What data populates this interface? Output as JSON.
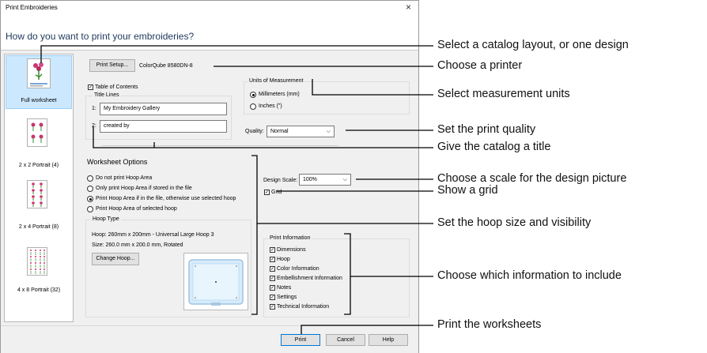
{
  "window": {
    "title": "Print Embroideries",
    "close": "×"
  },
  "header": {
    "prompt": "How do you want to print your embroideries?"
  },
  "layouts": [
    {
      "label": "Full worksheet"
    },
    {
      "label": "2 x 2 Portrait (4)"
    },
    {
      "label": "2 x 4 Portrait (8)"
    },
    {
      "label": "4 x 8 Portrait (32)"
    }
  ],
  "printer": {
    "setup_label": "Print Setup...",
    "name": "ColorQube 8580DN-8"
  },
  "toc": {
    "label": "Table of Contents",
    "checked": "✓"
  },
  "title_lines": {
    "legend": "Title Lines",
    "line1_num": "1:",
    "line1_value": "My Embroidery Gallery",
    "line2_num": "2:",
    "line2_value": "created by"
  },
  "units": {
    "legend": "Units of Measurement",
    "mm_label": "Millimeters (mm)",
    "in_label": "Inches (\")"
  },
  "quality": {
    "label": "Quality:",
    "value": "Normal"
  },
  "worksheet": {
    "heading": "Worksheet Options",
    "opt1": "Do not print Hoop Area",
    "opt2": "Only print Hoop Area if stored in the file",
    "opt3": "Print Hoop Area if in the file, otherwise use selected hoop",
    "opt4": "Print Hoop Area of selected hoop"
  },
  "hoop": {
    "legend": "Hoop Type",
    "hoop_line": "Hoop:  260mm x 200mm - Universal Large Hoop 3",
    "size_line": "Size:   260.0 mm x 200.0 mm, Rotated",
    "change_label": "Change Hoop..."
  },
  "design_scale": {
    "label": "Design Scale:",
    "value": "100%"
  },
  "grid": {
    "label": "Grid",
    "checked": "✓"
  },
  "print_info": {
    "legend": "Print Information",
    "items": [
      "Dimensions",
      "Hoop",
      "Color Information",
      "Embellishment Information",
      "Notes",
      "Settings",
      "Technical Information"
    ],
    "check": "✓"
  },
  "buttons": {
    "print": "Print",
    "cancel": "Cancel",
    "help": "Help"
  },
  "callouts": [
    "Select a catalog layout, or one design",
    "Choose a printer",
    "Select measurement units",
    "Set the print quality",
    "Give the catalog a title",
    "Choose a scale for the design picture",
    "Show a grid",
    "Set the hoop size and visibility",
    "Choose which information to include",
    "Print the worksheets"
  ],
  "colors": {
    "header_text": "#1e395b",
    "selection": "#cce8ff",
    "hoop_fill": "#d6ecfb"
  }
}
